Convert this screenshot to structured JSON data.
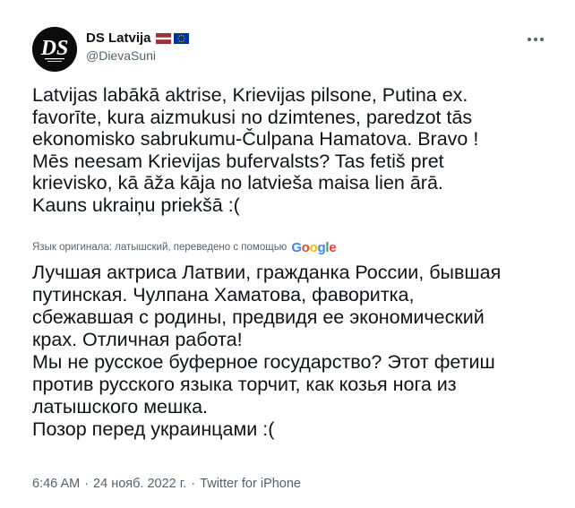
{
  "author": {
    "avatar_icon": "ds-logo-avatar",
    "name": "DS Latvija",
    "handle": "@DievaSuni",
    "badges": [
      "latvia-flag-icon",
      "eu-flag-icon"
    ]
  },
  "menu": {
    "icon": "more-horizontal-icon"
  },
  "tweet": {
    "text": "Latvijas labākā aktrise, Krievijas pilsone, Putina ex.\nfavorīte, kura aizmukusi no dzimtenes, paredzot tās\nekonomisko sabrukumu-Čulpana Hamatova. Bravo !\nMēs neesam Krievijas bufervalsts?  Tas fetiš pret\nkrievisko, kā āža kāja no latvieša maisa lien ārā.\nKauns ukraiņu priekšā :(",
    "translation_note": "Язык оригинала: латышский, переведено с помощью",
    "translation_provider": "Google",
    "translation": "Лучшая актриса Латвии, гражданка России, бывшая\nпутинская. Чулпана Хаматова, фаворитка,\nсбежавшая с родины, предвидя ее экономический\nкрах. Отличная работа!\nМы не русское буферное государство? Этот фетиш\nпротив русского языка торчит, как козья нога из\nлатышского мешка.\nПозор перед украинцами :("
  },
  "meta": {
    "time": "6:46 AM",
    "separator": "·",
    "date": "24 нояб. 2022 г.",
    "source": "Twitter for iPhone"
  },
  "colors": {
    "text": "#0f1419",
    "secondary": "#536471",
    "latvia_red": "#9e3039",
    "eu_blue": "#003399",
    "eu_gold": "#ffcc00"
  }
}
